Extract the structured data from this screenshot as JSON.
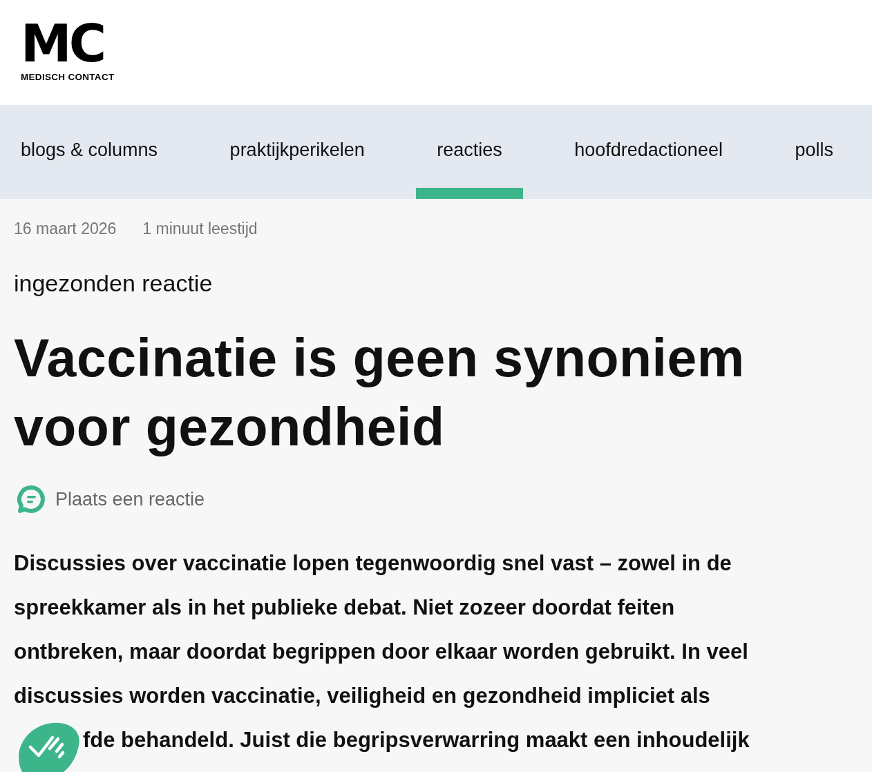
{
  "logo": {
    "mark": "MC",
    "name": "MEDISCH CONTACT"
  },
  "nav": [
    {
      "label": "blogs & columns",
      "selected": false
    },
    {
      "label": "praktijkperikelen",
      "selected": false
    },
    {
      "label": "reacties",
      "selected": true
    },
    {
      "label": "hoofdredactioneel",
      "selected": false
    },
    {
      "label": "polls",
      "selected": false
    }
  ],
  "article": {
    "date": "16 maart 2026",
    "reading_time": "1 minuut leestijd",
    "category": "ingezonden reactie",
    "title": "Vaccinatie is geen synoniem voor gezondheid",
    "comment_link": "Plaats een reactie",
    "intro": "Discussies over vaccinatie lopen tegenwoordig snel vast – zowel in de spreekkamer als in het publieke debat. Niet zozeer doordat feiten ontbreken, maar doordat begrippen door elkaar worden gebruikt. In veel discussies worden vaccinatie, veiligheid en gezondheid impliciet als",
    "intro_tail": "fde behandeld. Juist die begripsverwarring maakt een inhoudelijk"
  }
}
